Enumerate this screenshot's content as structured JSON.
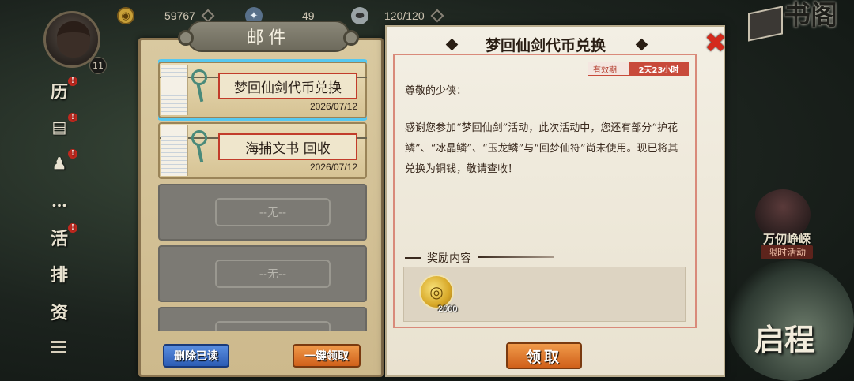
{
  "resources": [
    {
      "icon": "coin-icon",
      "glyph": "◉",
      "value": "59767"
    },
    {
      "icon": "jade-icon",
      "glyph": "✦",
      "value": "49"
    },
    {
      "icon": "stamina-icon",
      "glyph": "⬬",
      "value": "120/120"
    }
  ],
  "player": {
    "level": "11"
  },
  "side_nav": [
    {
      "label": "历",
      "name": "nav-history",
      "badge": "!"
    },
    {
      "label": "▤",
      "name": "nav-card-icon",
      "badge": "!"
    },
    {
      "label": "♟",
      "name": "nav-friends-icon",
      "badge": "!"
    },
    {
      "label": "…",
      "name": "nav-chat-icon",
      "badge": ""
    },
    {
      "label": "活",
      "name": "nav-events",
      "badge": "!"
    },
    {
      "label": "排",
      "name": "nav-rank",
      "badge": ""
    },
    {
      "label": "资",
      "name": "nav-resources",
      "badge": ""
    }
  ],
  "right_deco": {
    "book_title": "书阁",
    "event_title": "万仞峥嵘",
    "event_tag": "限时活动",
    "qicheng": "启程"
  },
  "mail_panel": {
    "title": "邮件",
    "items": [
      {
        "subject": "梦回仙剑代币兑换",
        "date": "2026/07/12",
        "selected": true
      },
      {
        "subject": "海捕文书 回收",
        "date": "2026/07/12",
        "selected": false
      }
    ],
    "empty_label": "--无--",
    "delete_read_label": "删除已读",
    "claim_all_label": "一键领取"
  },
  "mail_detail": {
    "title": "梦回仙剑代币兑换",
    "expiry_label": "有效期",
    "expiry_value": "2天23小时",
    "greeting": "尊敬的少侠：",
    "body": "感谢您参加“梦回仙剑”活动，此次活动中，您还有部分“护花鳞”、“冰晶鳞”、“玉龙鳞”与“回梦仙符”尚未使用。现已将其兑换为铜钱，敬请查收！",
    "reward_label": "奖励内容",
    "reward": {
      "icon": "copper-coin-icon",
      "glyph": "◎",
      "quantity": "2000"
    },
    "claim_label": "领取",
    "close_glyph": "✖"
  },
  "colors": {
    "accent_red": "#c23c2a",
    "selected_outline": "#56c8f0",
    "orange_button": "#d0601a",
    "blue_button": "#2c5cb4"
  }
}
